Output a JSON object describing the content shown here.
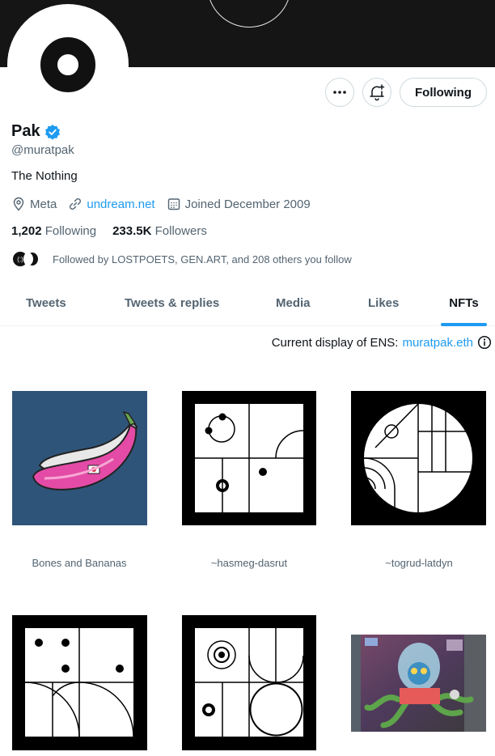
{
  "profile": {
    "display_name": "Pak",
    "handle": "@muratpak",
    "bio": "The Nothing",
    "location": "Meta",
    "website": "undream.net",
    "joined": "Joined December 2009",
    "following_count": "1,202",
    "following_label": "Following",
    "followers_count": "233.5K",
    "followers_label": "Followers",
    "followed_by": "Followed by LOSTPOETS, GEN.ART, and 208 others you follow",
    "mini_avatar_text": "(:)"
  },
  "actions": {
    "more_icon": "more-icon",
    "notify_icon": "bell-plus-icon",
    "follow_label": "Following"
  },
  "tabs": [
    {
      "label": "Tweets"
    },
    {
      "label": "Tweets & replies"
    },
    {
      "label": "Media"
    },
    {
      "label": "Likes"
    },
    {
      "label": "NFTs",
      "active": true
    }
  ],
  "ens": {
    "prefix": "Current display of ENS:",
    "name": "muratpak.eth"
  },
  "nfts": [
    {
      "caption": "Bones and Bananas"
    },
    {
      "caption": "~hasmeg-dasrut"
    },
    {
      "caption": "~togrud-latdyn"
    },
    {
      "caption": ""
    },
    {
      "caption": ""
    },
    {
      "caption": ""
    }
  ],
  "colors": {
    "accent": "#1d9bf0",
    "verified": "#1d9bf0",
    "banner": "#151515"
  }
}
